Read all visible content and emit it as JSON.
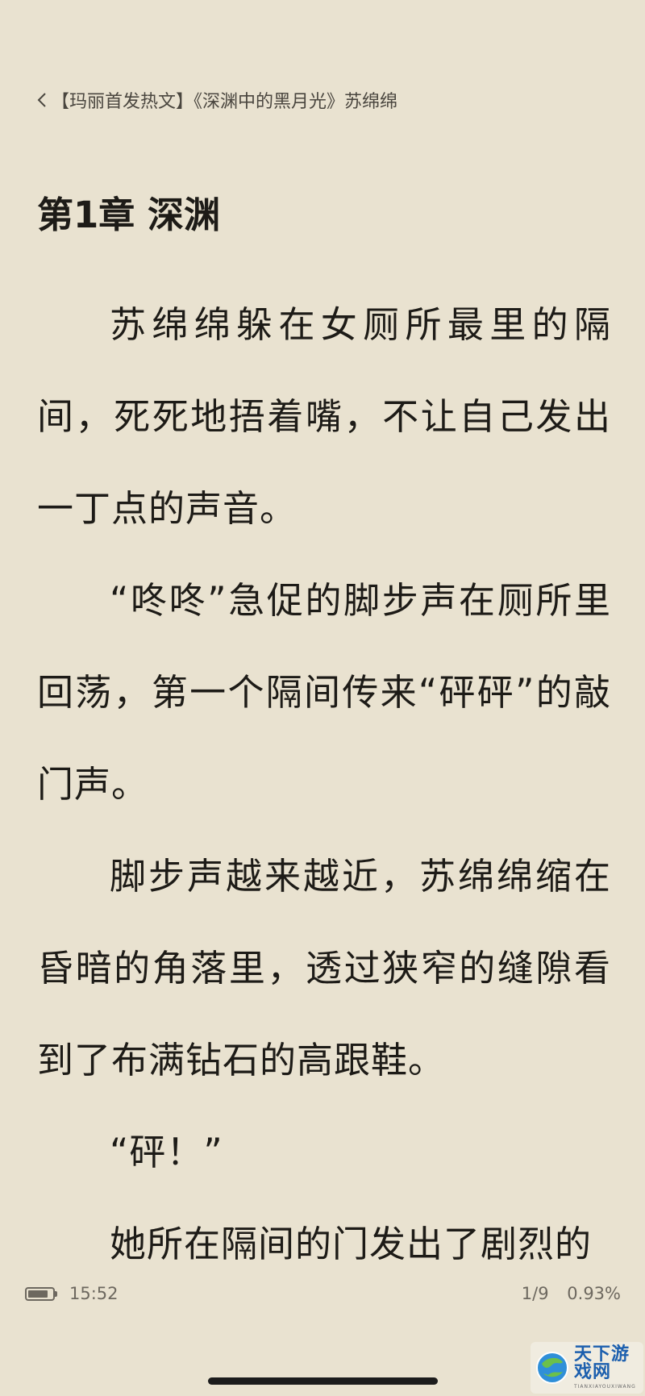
{
  "header": {
    "book_title": "【玛丽首发热文】《深渊中的黑月光》苏绵绵"
  },
  "chapter": {
    "title": "第1章 深渊",
    "paragraphs": [
      "苏绵绵躲在女厕所最里的隔间，死死地捂着嘴，不让自己发出一丁点的声音。",
      "“咚咚”急促的脚步声在厕所里回荡，第一个隔间传来“砰砰”的敲门声。",
      "脚步声越来越近，苏绵绵缩在昏暗的角落里，透过狭窄的缝隙看到了布满钻石的高跟鞋。",
      "“砰！”",
      "她所在隔间的门发出了剧烈的"
    ]
  },
  "footer": {
    "time": "15:52",
    "battery_level": 0.85,
    "page": "1/9",
    "progress": "0.93%"
  },
  "watermark": {
    "name": "天下游戏网",
    "sub": "TIANXIAYOUXIWANG"
  },
  "colors": {
    "background": "#e9e2d0",
    "text": "#1d1b17",
    "secondary": "#6d685f",
    "watermark_blue": "#1c5fae"
  }
}
